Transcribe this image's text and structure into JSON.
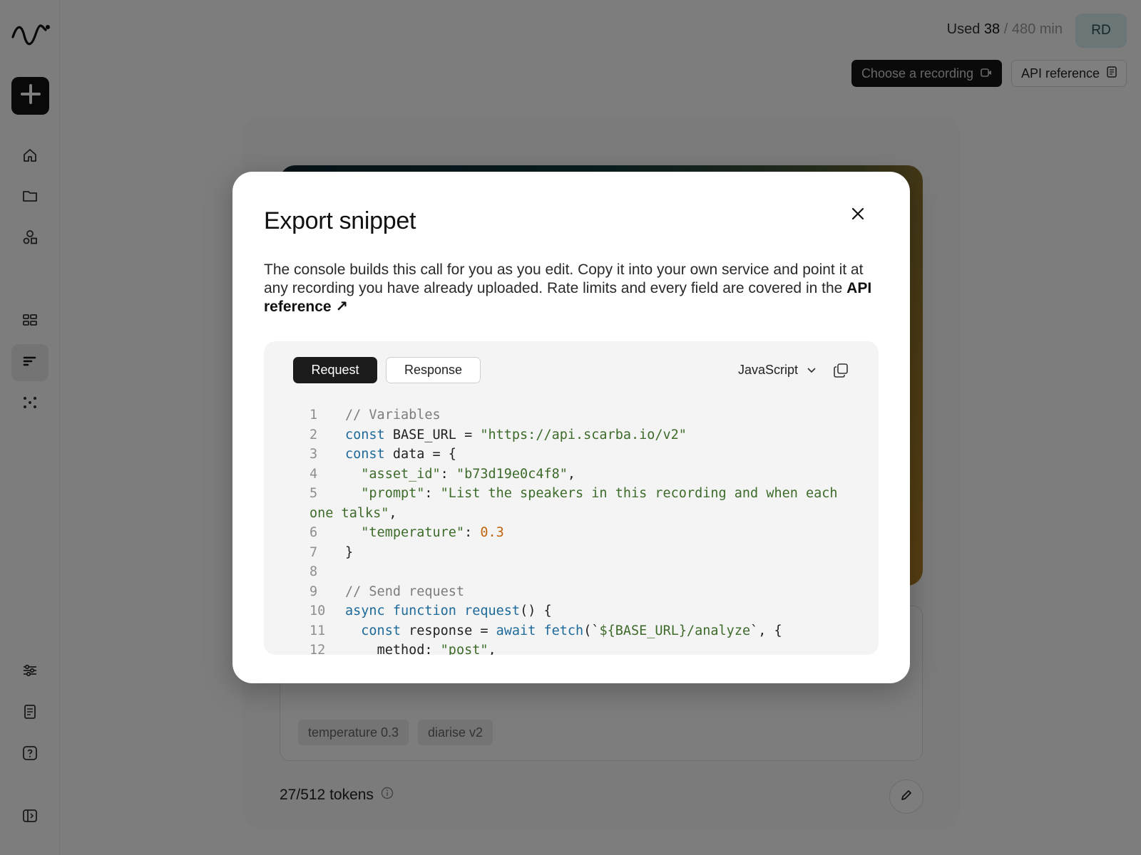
{
  "usage": {
    "label": "Used",
    "used": "38",
    "separator": "/",
    "total": "480 min"
  },
  "user": {
    "initials": "RD"
  },
  "toolbar": {
    "choose_recording": "Choose a recording",
    "api_reference": "API reference"
  },
  "background": {
    "tags": [
      "temperature 0.3",
      "diarise v2"
    ],
    "tokens": "27/512 tokens"
  },
  "modal": {
    "title": "Export snippet",
    "description": "The console builds this call for you as you edit. Copy it into your own service and point it at any recording you have already uploaded. Rate limits and every field are covered in the",
    "link_text": "API reference",
    "link_arrow": "↗",
    "tabs": {
      "request": "Request",
      "response": "Response"
    },
    "language": "JavaScript",
    "line_numbers": [
      "1",
      "2",
      "3",
      "4",
      "5",
      "",
      "6",
      "7",
      "8",
      "9",
      "10",
      "11",
      "12"
    ],
    "code": {
      "l1": "// Variables",
      "l2_kw": "const",
      "l2_rest": " BASE_URL = ",
      "l2_str": "\"https://api.scarba.io/v2\"",
      "l3_kw": "const",
      "l3_rest": " data = {",
      "l4_key": "\"asset_id\"",
      "l4_sep": ": ",
      "l4_str": "\"b73d19e0c4f8\"",
      "l4_end": ",",
      "l5_key": "\"prompt\"",
      "l5_sep": ": ",
      "l5_str": "\"List the speakers in this recording and when each",
      "l5b_str": "one talks\"",
      "l5b_end": ",",
      "l6_key": "\"temperature\"",
      "l6_sep": ": ",
      "l6_num": "0.3",
      "l7": "}",
      "l8": "",
      "l9": "// Send request",
      "l10_kw1": "async",
      "l10_kw2": "function",
      "l10_fn": "request",
      "l10_rest": "() {",
      "l11_kw": "const",
      "l11_rest": " response = ",
      "l11_kw2": "await",
      "l11_fn": "fetch",
      "l11_open": "(`",
      "l11_str": "${BASE_URL}/analyze",
      "l11_end": "`, {",
      "l12_key": "method",
      "l12_sep": ": ",
      "l12_str": "\"post\"",
      "l12_end": ","
    }
  }
}
